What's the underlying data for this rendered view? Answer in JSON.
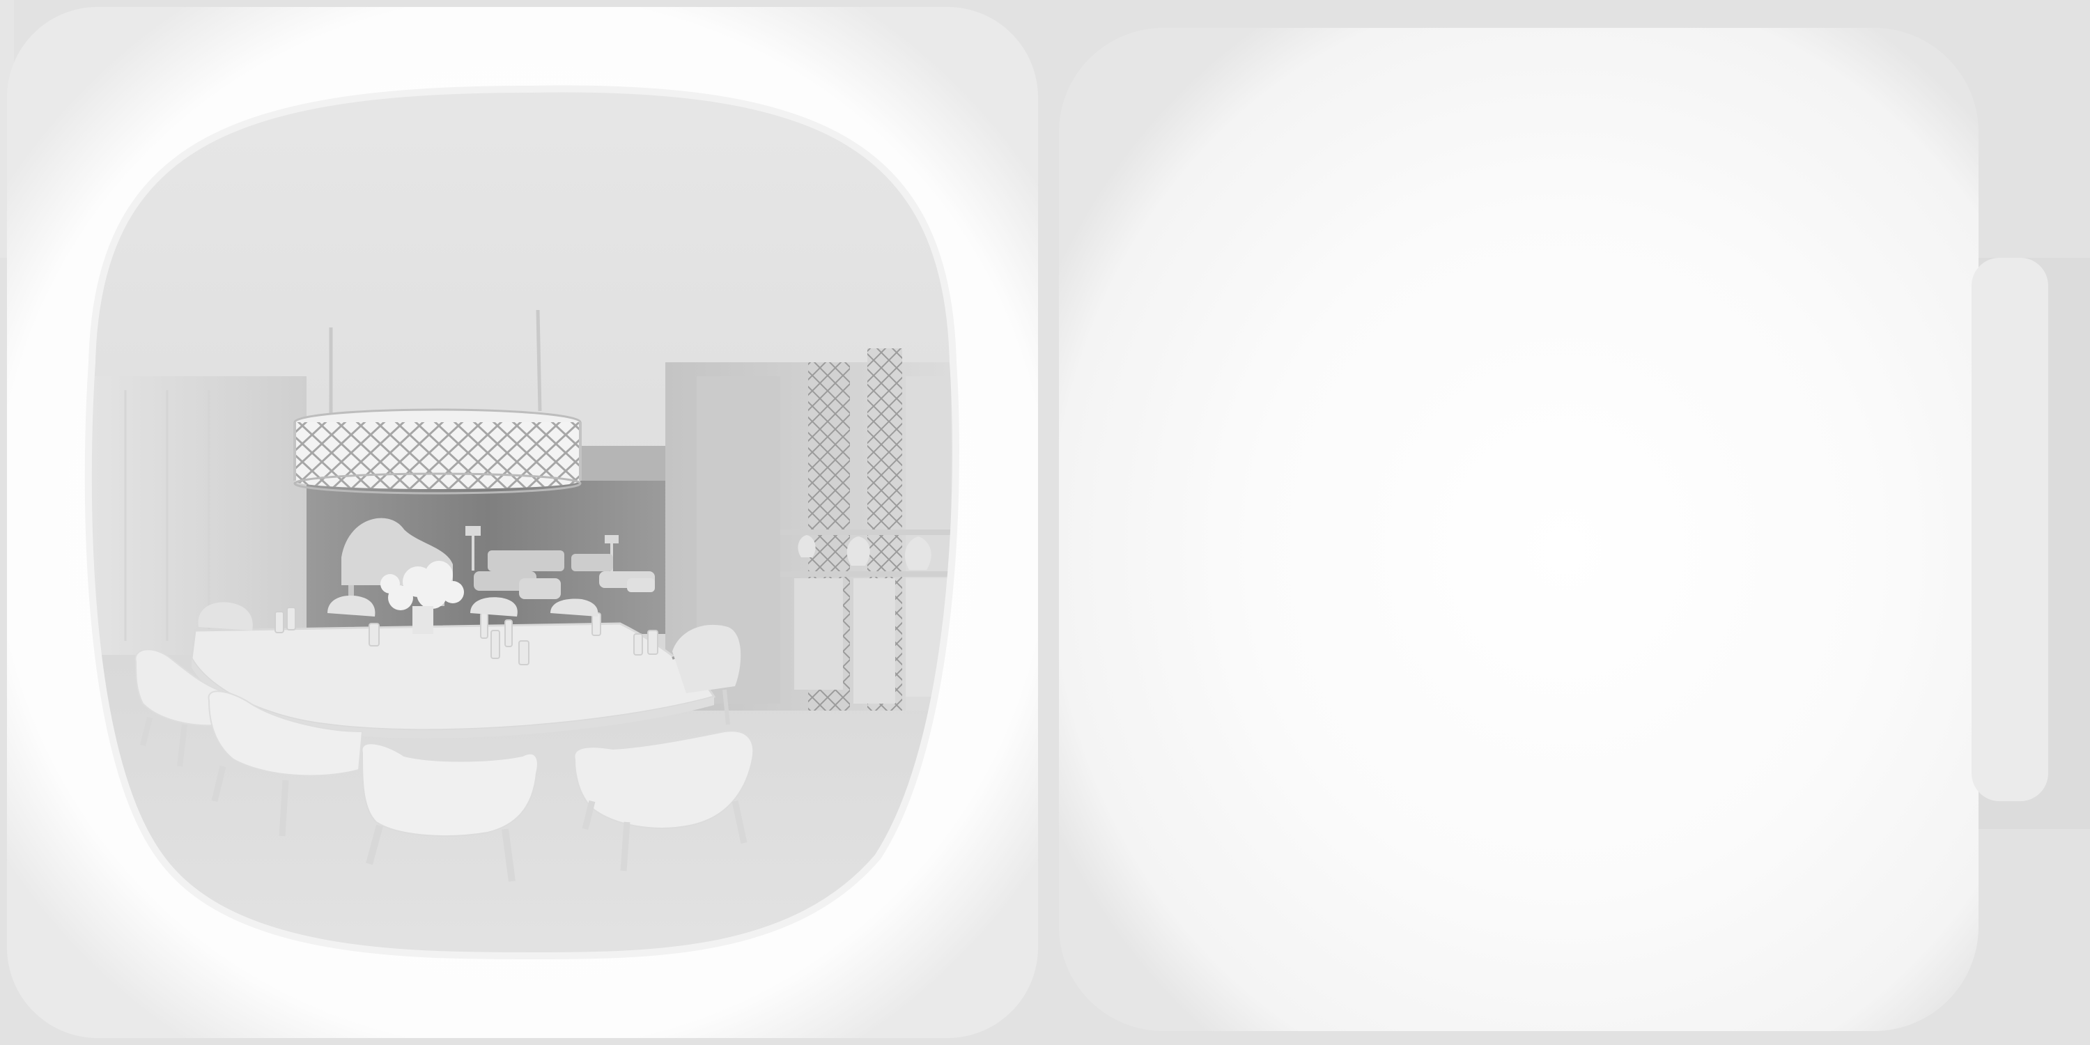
{
  "image": {
    "kind": "depth-map-panorama",
    "palette": {
      "background": "#e2e2e2",
      "panel_white": "#fbfbfb",
      "room_light": "#e6e6e6",
      "room_mid": "#cfcfcf",
      "room_dark": "#8f8f8f",
      "furniture": "#efefef",
      "chandelier": "#f3f3f3"
    },
    "icons": [
      "chandelier-icon",
      "grand-piano-icon",
      "dining-table-icon",
      "armchair-icon",
      "vase-icon",
      "floor-lamp-icon"
    ]
  }
}
